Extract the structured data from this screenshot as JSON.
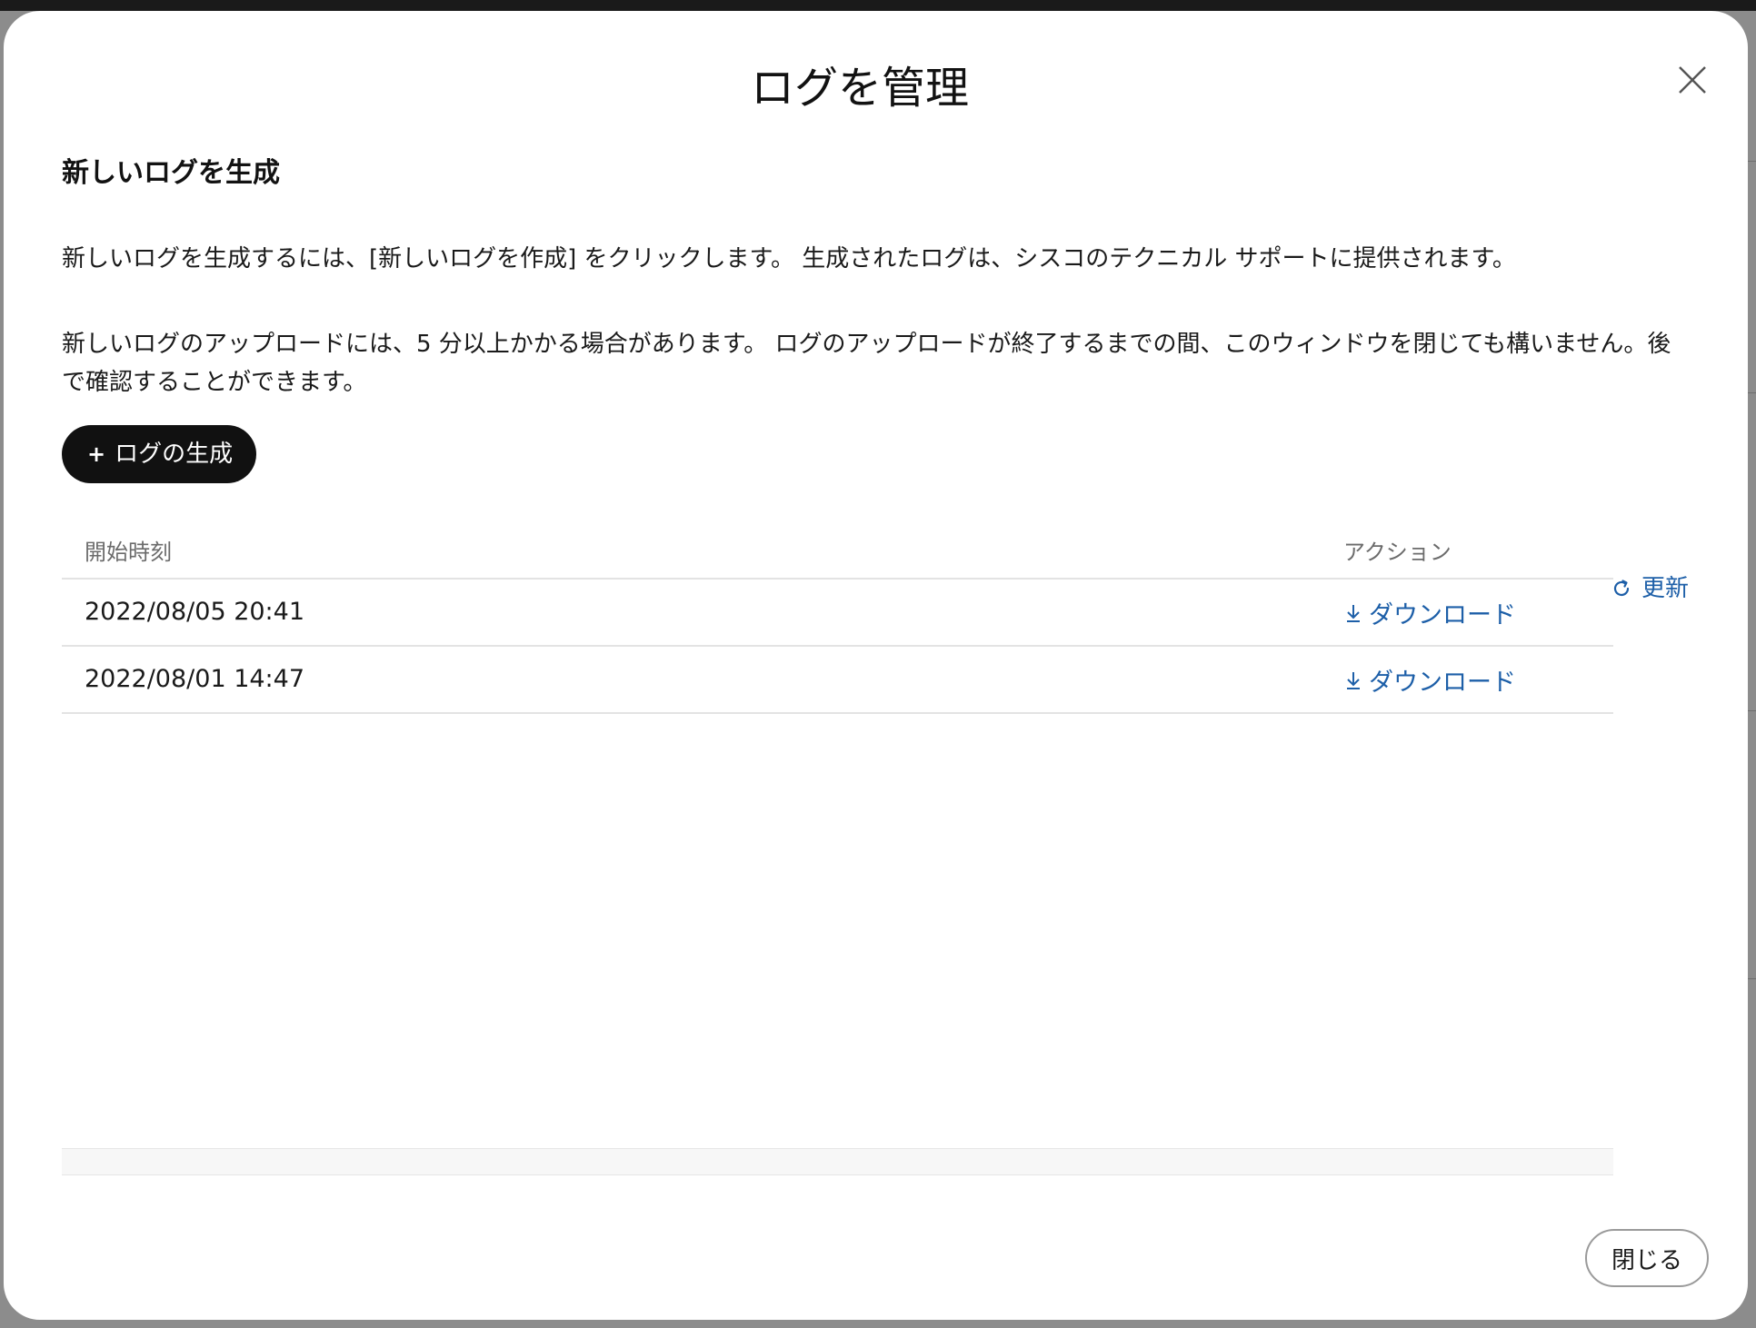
{
  "modal": {
    "title": "ログを管理",
    "close_icon": "close-icon"
  },
  "generate_section": {
    "heading": "新しいログを生成",
    "description_1": "新しいログを生成するには、[新しいログを作成] をクリックします。 生成されたログは、シスコのテクニカル サポートに提供されます。",
    "description_2": "新しいログのアップロードには、5 分以上かかる場合があります。 ログのアップロードが終了するまでの間、このウィンドウを閉じても構いません。後で確認することができます。",
    "button_plus": "+",
    "button_label": "ログの生成"
  },
  "refresh": {
    "icon": "refresh-icon",
    "label": "更新"
  },
  "table": {
    "headers": {
      "start_time": "開始時刻",
      "action": "アクション"
    },
    "rows": [
      {
        "start_time": "2022/08/05 20:41",
        "action": "ダウンロード",
        "action_icon": "download-icon"
      },
      {
        "start_time": "2022/08/01 14:47",
        "action": "ダウンロード",
        "action_icon": "download-icon"
      }
    ]
  },
  "footer": {
    "close_label": "閉じる"
  },
  "colors": {
    "accent_link": "#1d5fa8",
    "primary_button": "#111111",
    "modal_bg": "#ffffff"
  }
}
